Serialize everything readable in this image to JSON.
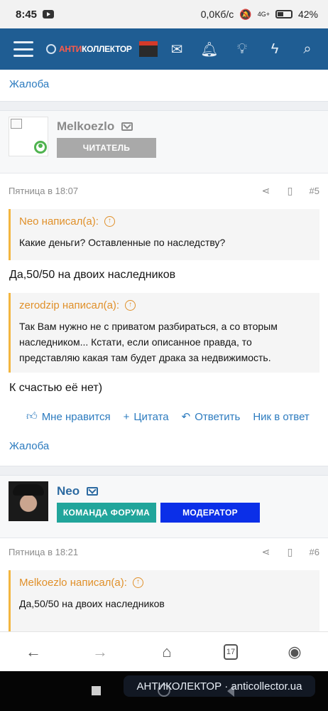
{
  "status_bar": {
    "time": "8:45",
    "network_speed": "0,0Кб/с",
    "battery": "42%",
    "signal": "4G+"
  },
  "header": {
    "logo_part_red": "АНТИ",
    "logo_part_white": "КОЛЛЕКТОР",
    "icons": [
      "mail-icon",
      "bell-icon",
      "lightbulb-icon",
      "bolt-icon",
      "search-icon"
    ]
  },
  "colors": {
    "header_bg": "#1f5d93",
    "link": "#2c7bbf",
    "quote_accent": "#f3b640",
    "online": "#4fb34f",
    "role_reader": "#a9a9a9",
    "role_team": "#21a59b",
    "role_moderator": "#0b2fe8"
  },
  "top": {
    "complaint_link": "Жалоба"
  },
  "posts": [
    {
      "username": "Melkoezlo",
      "roles": [
        "ЧИТАТЕЛЬ"
      ],
      "date": "Пятница в 18:07",
      "number": "#5",
      "quotes": [
        {
          "author": "Neo написал(а):",
          "text": "Какие деньги? Оставленные по наследству?"
        },
        {
          "author": "zerodzip написал(а):",
          "text": "Так Вам нужно не с приватом разбираться, а со вторым наследником... Кстати, если описанное правда, то представляю какая там будет драка за недвижимость."
        }
      ],
      "reply_1": "Да,50/50 на двоих наследников",
      "reply_2": "К счастью её нет)",
      "actions": {
        "like": "Мне нравится",
        "quote": "Цитата",
        "reply": "Ответить",
        "nick": "Ник в ответ"
      },
      "complaint_link": "Жалоба"
    },
    {
      "username": "Neo",
      "roles": [
        "КОМАНДА ФОРУМА",
        "МОДЕРАТОР"
      ],
      "date": "Пятница в 18:21",
      "number": "#6",
      "quotes": [
        {
          "author": "Melkoezlo написал(а):",
          "text": "Да,50/50 на двоих наследников"
        }
      ]
    }
  ],
  "browser_bar": {
    "tab_count": "17"
  },
  "watermark": "АНТИКОЛЕКТОР · anticollector.ua"
}
